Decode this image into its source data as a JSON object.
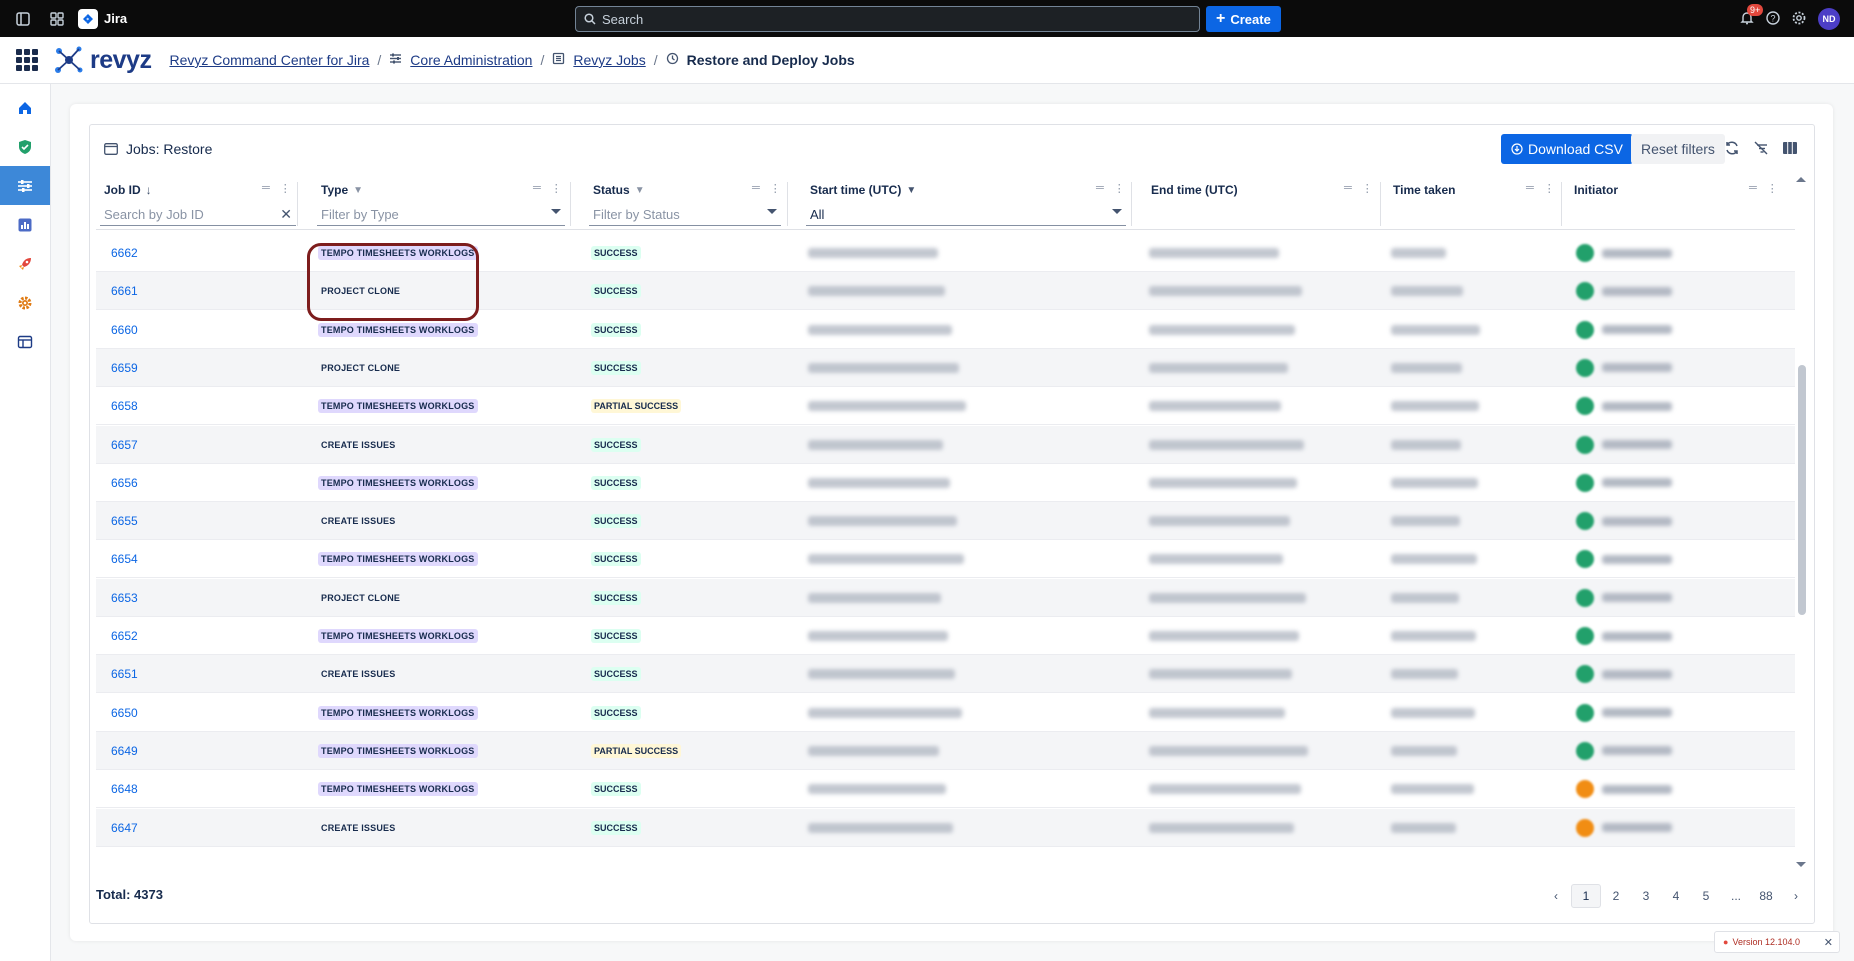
{
  "topbar": {
    "product": "Jira",
    "search_placeholder": "Search",
    "create_label": "Create",
    "notif_count": "9+",
    "avatar_initials": "ND"
  },
  "app": {
    "logo_text": "revyz",
    "breadcrumb": [
      "Revyz Command Center for Jira",
      "Core Administration",
      "Revyz Jobs",
      "Restore and Deploy Jobs"
    ]
  },
  "card": {
    "title": "Jobs: Restore",
    "download_label": "Download CSV",
    "reset_label": "Reset filters"
  },
  "columns": {
    "job_id": "Job ID",
    "type": "Type",
    "status": "Status",
    "start": "Start time (UTC)",
    "end": "End time (UTC)",
    "taken": "Time taken",
    "initiator": "Initiator"
  },
  "filters": {
    "job_id_placeholder": "Search by Job ID",
    "type_placeholder": "Filter by Type",
    "status_placeholder": "Filter by Status",
    "start_value": "All"
  },
  "rows": [
    {
      "id": "6662",
      "type": "TEMPO TIMESHEETS WORKLOGS",
      "status": "SUCCESS"
    },
    {
      "id": "6661",
      "type": "PROJECT CLONE",
      "status": "SUCCESS"
    },
    {
      "id": "6660",
      "type": "TEMPO TIMESHEETS WORKLOGS",
      "status": "SUCCESS"
    },
    {
      "id": "6659",
      "type": "PROJECT CLONE",
      "status": "SUCCESS"
    },
    {
      "id": "6658",
      "type": "TEMPO TIMESHEETS WORKLOGS",
      "status": "PARTIAL SUCCESS"
    },
    {
      "id": "6657",
      "type": "CREATE ISSUES",
      "status": "SUCCESS"
    },
    {
      "id": "6656",
      "type": "TEMPO TIMESHEETS WORKLOGS",
      "status": "SUCCESS"
    },
    {
      "id": "6655",
      "type": "CREATE ISSUES",
      "status": "SUCCESS"
    },
    {
      "id": "6654",
      "type": "TEMPO TIMESHEETS WORKLOGS",
      "status": "SUCCESS"
    },
    {
      "id": "6653",
      "type": "PROJECT CLONE",
      "status": "SUCCESS"
    },
    {
      "id": "6652",
      "type": "TEMPO TIMESHEETS WORKLOGS",
      "status": "SUCCESS"
    },
    {
      "id": "6651",
      "type": "CREATE ISSUES",
      "status": "SUCCESS"
    },
    {
      "id": "6650",
      "type": "TEMPO TIMESHEETS WORKLOGS",
      "status": "SUCCESS"
    },
    {
      "id": "6649",
      "type": "TEMPO TIMESHEETS WORKLOGS",
      "status": "PARTIAL SUCCESS"
    },
    {
      "id": "6648",
      "type": "TEMPO TIMESHEETS WORKLOGS",
      "status": "SUCCESS"
    },
    {
      "id": "6647",
      "type": "CREATE ISSUES",
      "status": "SUCCESS"
    }
  ],
  "footer": {
    "total": "Total: 4373",
    "pages": [
      "1",
      "2",
      "3",
      "4",
      "5",
      "...",
      "88"
    ],
    "active_page": "1"
  },
  "version": "Version 12.104.0",
  "colors": {
    "brand_blue": "#0c66e4",
    "nav_active": "#3d88d8",
    "tempo_tag": "#dfd8fd",
    "success_tag": "#dcfff1",
    "partial_tag": "#fff7d6",
    "highlight": "#7d1d1d"
  }
}
